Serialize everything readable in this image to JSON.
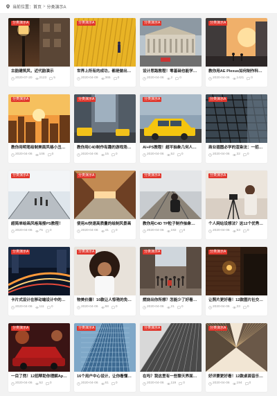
{
  "breadcrumb": {
    "label": "当前位置：",
    "home": "首页",
    "separator": ">",
    "current": "分类演示A"
  },
  "colors": {
    "accent": "#e0352b",
    "meta": "#999999"
  },
  "cards": [
    {
      "tag": "分类演示A",
      "title": "古韵建筑风，近代韵演示",
      "date": "2020-07-20",
      "views": "2123",
      "comments": "5",
      "scene": "lamp"
    },
    {
      "tag": "分类演示A",
      "title": "世界上所有的成功，都是做出了“…",
      "date": "2020-04-09",
      "views": "365",
      "comments": "0",
      "scene": "yellow"
    },
    {
      "tag": "分类演示A",
      "title": "设计思路教程！零基础也能学会的…",
      "date": "2020-04-06",
      "views": "2",
      "comments": "0",
      "scene": "europe"
    },
    {
      "tag": "分类演示A",
      "title": "教你用AE Plexus如何制作科技小…",
      "date": "2020-04-06",
      "views": "1421",
      "comments": "0",
      "scene": "sunset-street"
    },
    {
      "tag": "分类演示A",
      "title": "教你用明笔绘制美面风格小丑插画",
      "date": "2020-04-06",
      "views": "106",
      "comments": "0",
      "scene": "city-sunset"
    },
    {
      "tag": "分类演示A",
      "title": "教你用C4D制作有趣的游戏场景！",
      "date": "2020-04-06",
      "views": "15",
      "comments": "0",
      "scene": "taxi-street"
    },
    {
      "tag": "分类演示A",
      "title": "AI+PS教程！超平抽象几何人物绘制",
      "date": "2020-04-06",
      "views": "52",
      "comments": "0",
      "scene": "taxi"
    },
    {
      "tag": "分类演示A",
      "title": "商业插图必学的渲染法：一招提升…",
      "date": "2020-04-06",
      "views": "32",
      "comments": "0",
      "scene": "fire-escape"
    },
    {
      "tag": "分类演示A",
      "title": "超简单绘画风格海报PS教程！",
      "date": "2020-04-06",
      "views": "75",
      "comments": "0",
      "scene": "bridge-people"
    },
    {
      "tag": "分类演示A",
      "title": "使用AI快速高质量的绘制风景画",
      "date": "2020-04-06",
      "views": "41",
      "comments": "0",
      "scene": "station"
    },
    {
      "tag": "分类演示A",
      "title": "教你用C4D TP粒子制作抽象动画",
      "date": "2020-04-06",
      "views": "192",
      "comments": "0",
      "scene": "rail-woman"
    },
    {
      "tag": "分类演示A",
      "title": "个人网站设想法？这12个优秀案例…",
      "date": "2020-04-06",
      "views": "53",
      "comments": "0",
      "scene": "camera-woman"
    },
    {
      "tag": "分类演示A",
      "title": "卡片式设计在移动端设计中的正确…",
      "date": "2020-04-06",
      "views": "111",
      "comments": "0",
      "scene": "night-traffic"
    },
    {
      "tag": "分类演示A",
      "title": "物美价廉！10款让人惊艳的免费的…",
      "date": "2020-04-06",
      "views": "68",
      "comments": "0",
      "scene": "curly-woman"
    },
    {
      "tag": "分类演示A",
      "title": "燃烧出你所想？怎能少了好看的前…",
      "date": "2020-04-06",
      "views": "21",
      "comments": "0",
      "scene": "crowd-street"
    },
    {
      "tag": "分类演示A",
      "title": "让照片更好看！12款图片社交App…",
      "date": "2020-04-06",
      "views": "33",
      "comments": "0",
      "scene": "brick-night"
    },
    {
      "tag": "分类演示A",
      "title": "一目了然！12招帮助你理解App界…",
      "date": "2020-04-06",
      "views": "52",
      "comments": "0",
      "scene": "red-car"
    },
    {
      "tag": "分类演示A",
      "title": "16个用户中心设计，让你看懂展示更…",
      "date": "2020-04-06",
      "views": "61",
      "comments": "0",
      "scene": "glass-tower"
    },
    {
      "tag": "分类演示A",
      "title": "在吗？我这里有一些聊天界面的你…",
      "date": "2020-04-06",
      "views": "119",
      "comments": "0",
      "scene": "bw-building"
    },
    {
      "tag": "分类演示A",
      "title": "好评要更好看！12款桌面音乐播放…",
      "date": "2020-04-06",
      "views": "194",
      "comments": "0",
      "scene": "skyscraper-up"
    }
  ]
}
